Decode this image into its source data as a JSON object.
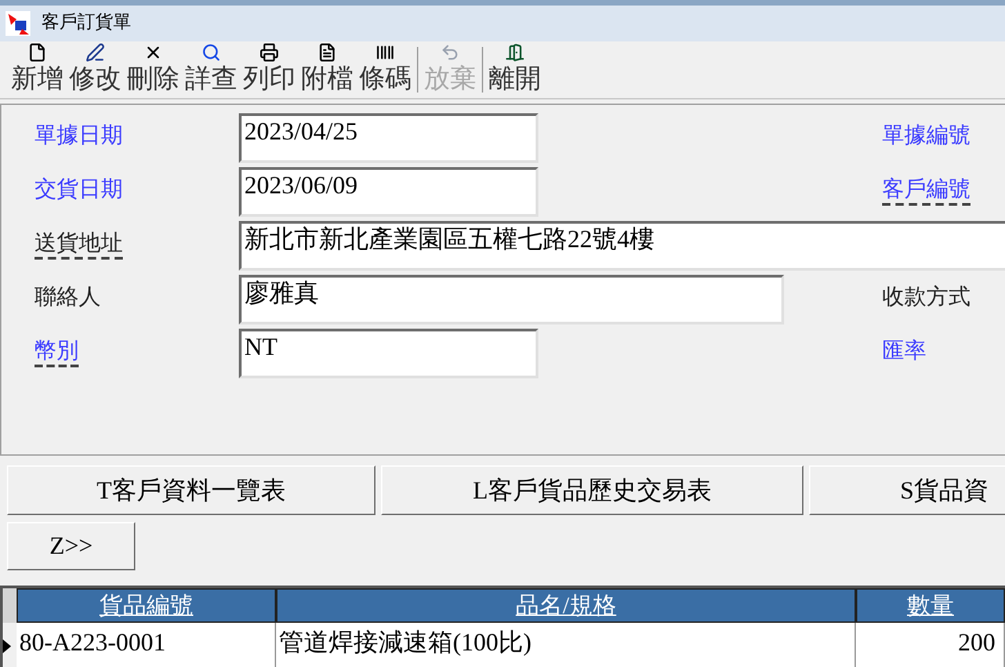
{
  "window": {
    "title": "客戶訂貨單"
  },
  "toolbar": [
    {
      "label": "新增",
      "disabled": false
    },
    {
      "label": "修改",
      "disabled": false
    },
    {
      "label": "刪除",
      "disabled": false
    },
    {
      "label": "詳查",
      "disabled": false
    },
    {
      "label": "列印",
      "disabled": false
    },
    {
      "label": "附檔",
      "disabled": false
    },
    {
      "label": "條碼",
      "disabled": false
    },
    {
      "label": "放棄",
      "disabled": true
    },
    {
      "label": "離開",
      "disabled": false
    }
  ],
  "form": [
    {
      "label": "單據日期",
      "linked": true,
      "underlined": false,
      "value": "2023/04/25",
      "kind": "short",
      "right_label": {
        "text": "單據編號",
        "linked": true,
        "underlined": false
      }
    },
    {
      "label": "交貨日期",
      "linked": true,
      "underlined": false,
      "value": "2023/06/09",
      "kind": "short",
      "right_label": {
        "text": "客戶編號",
        "linked": true,
        "underlined": true
      }
    },
    {
      "label": "送貨地址",
      "linked": false,
      "underlined": true,
      "value": "新北市新北產業園區五權七路22號4樓",
      "kind": "long"
    },
    {
      "label": "聯絡人",
      "linked": false,
      "underlined": false,
      "value": "廖雅真",
      "kind": "medium",
      "right_label": {
        "text": "收款方式",
        "linked": false,
        "underlined": false
      }
    },
    {
      "label": "幣別",
      "linked": true,
      "underlined": true,
      "value": "NT",
      "kind": "short",
      "right_label": {
        "text": "匯率",
        "linked": true,
        "underlined": false
      }
    }
  ],
  "buttons": [
    "T客戶資料一覽表",
    "L客戶貨品歷史交易表",
    "S貨品資"
  ],
  "more_button": "Z>>",
  "table": {
    "columns": [
      "貨品編號",
      "品名/規格",
      "數量"
    ],
    "rows": [
      {
        "selected": true,
        "cells": [
          "80-A223-0001",
          "管道焊接減速箱(100比)",
          "200"
        ]
      }
    ]
  }
}
